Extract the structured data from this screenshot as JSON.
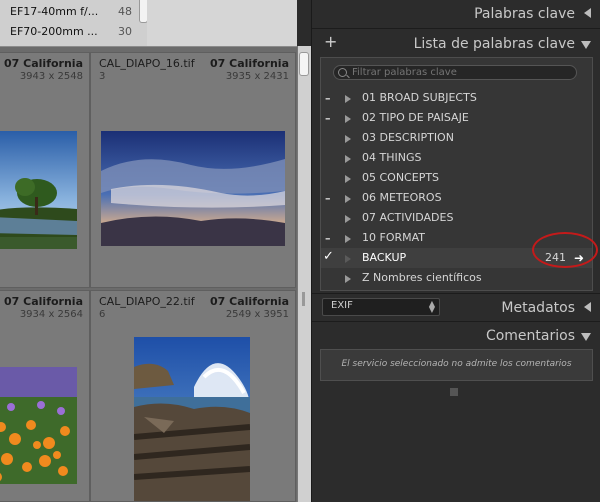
{
  "lens_list": [
    {
      "name": "EF17-40mm f/...",
      "count": "48"
    },
    {
      "name": "EF70-200mm ...",
      "count": "30"
    }
  ],
  "grid": {
    "row1": [
      {
        "filename": "",
        "folder": "07 California",
        "dims": "3943 x 2548",
        "index": ""
      },
      {
        "filename": "CAL_DIAPO_16.tif",
        "folder": "07 California",
        "dims": "3935 x 2431",
        "index": "3"
      }
    ],
    "row2": [
      {
        "filename": "",
        "folder": "07 California",
        "dims": "3934 x 2564",
        "index": ""
      },
      {
        "filename": "CAL_DIAPO_22.tif",
        "folder": "07 California",
        "dims": "2549 x 3951",
        "index": "6"
      }
    ]
  },
  "panels": {
    "keywords": {
      "title": "Palabras clave"
    },
    "keyword_list": {
      "title": "Lista de palabras clave",
      "add_symbol": "+",
      "filter_placeholder": "Filtrar palabras clave",
      "items": [
        {
          "label": "01 BROAD SUBJECTS",
          "marker": "–"
        },
        {
          "label": "02 TIPO DE PAISAJE",
          "marker": "–"
        },
        {
          "label": "03 DESCRIPTION",
          "marker": ""
        },
        {
          "label": "04 THINGS",
          "marker": ""
        },
        {
          "label": "05 CONCEPTS",
          "marker": ""
        },
        {
          "label": "06 METEOROS",
          "marker": "–"
        },
        {
          "label": "07 ACTIVIDADES",
          "marker": ""
        },
        {
          "label": "10 FORMAT",
          "marker": "–"
        },
        {
          "label": "BACKUP",
          "marker": "✓",
          "count": "241",
          "arrow": "➜"
        },
        {
          "label": "Z Nombres científicos",
          "marker": ""
        }
      ]
    },
    "metadata": {
      "title": "Metadatos",
      "preset": "EXIF"
    },
    "comments": {
      "title": "Comentarios",
      "message": "El servicio seleccionado no admite los comentarios"
    }
  },
  "colors": {
    "annotation": "#c41a1a"
  }
}
